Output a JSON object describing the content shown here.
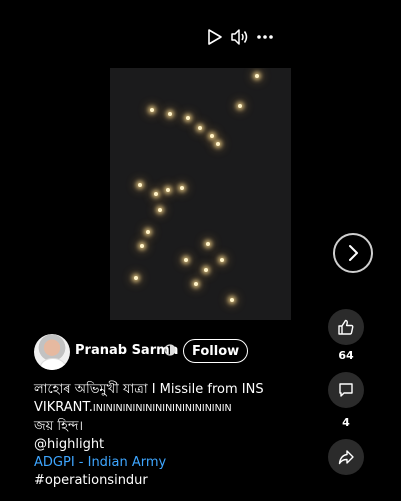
{
  "controls": {
    "play": "play-icon",
    "volume": "volume-icon",
    "more": "more-icon"
  },
  "channel": {
    "name": "Pranab Sarma",
    "follow_label": "Follow"
  },
  "description": {
    "line1": "লাহোৰ অভিমুখী যাত্ৰা I Missile from INS",
    "line2a": "VIKRANT.",
    "line2b": "ININININININININININININININ",
    "line3": "জয় হিন্দ।",
    "mention": "@highlight",
    "link": "ADGPI - Indian Army",
    "hashtag": "#operationsindur"
  },
  "actions": {
    "likes": "64",
    "comments": "4"
  },
  "colors": {
    "background": "#000000",
    "link": "#3ea6ff",
    "button_bg": "#2b2b2b"
  }
}
